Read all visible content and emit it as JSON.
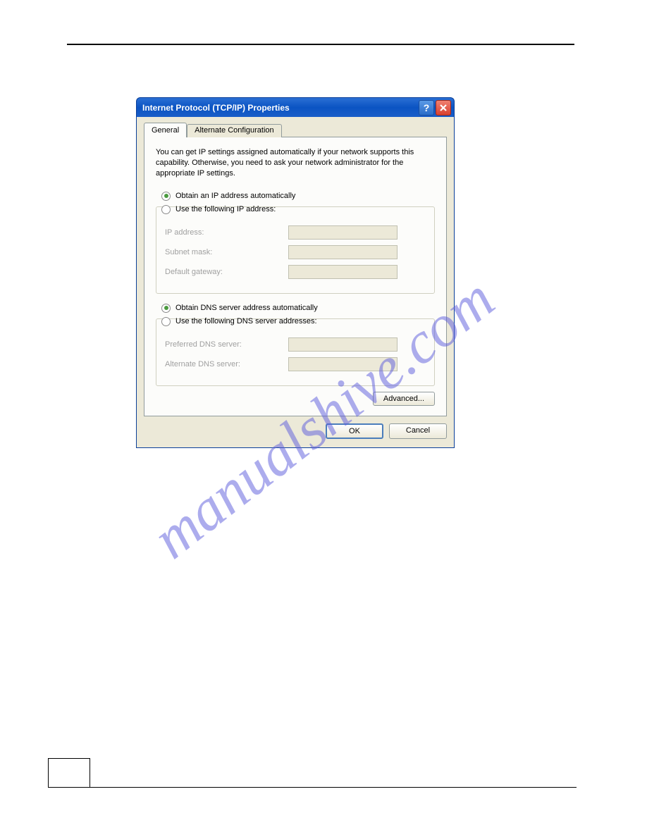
{
  "watermark": "manualshive.com",
  "dialog": {
    "title": "Internet Protocol (TCP/IP) Properties",
    "tabs": [
      {
        "label": "General",
        "active": true
      },
      {
        "label": "Alternate Configuration",
        "active": false
      }
    ],
    "description": "You can get IP settings assigned automatically if your network supports this capability. Otherwise, you need to ask your network administrator for the appropriate IP settings.",
    "ip_section": {
      "radio_auto": "Obtain an IP address automatically",
      "radio_manual": "Use the following IP address:",
      "fields": {
        "ip_address": "IP address:",
        "subnet_mask": "Subnet mask:",
        "default_gateway": "Default gateway:"
      }
    },
    "dns_section": {
      "radio_auto": "Obtain DNS server address automatically",
      "radio_manual": "Use the following DNS server addresses:",
      "fields": {
        "preferred": "Preferred DNS server:",
        "alternate": "Alternate DNS server:"
      }
    },
    "buttons": {
      "advanced": "Advanced...",
      "ok": "OK",
      "cancel": "Cancel"
    }
  }
}
